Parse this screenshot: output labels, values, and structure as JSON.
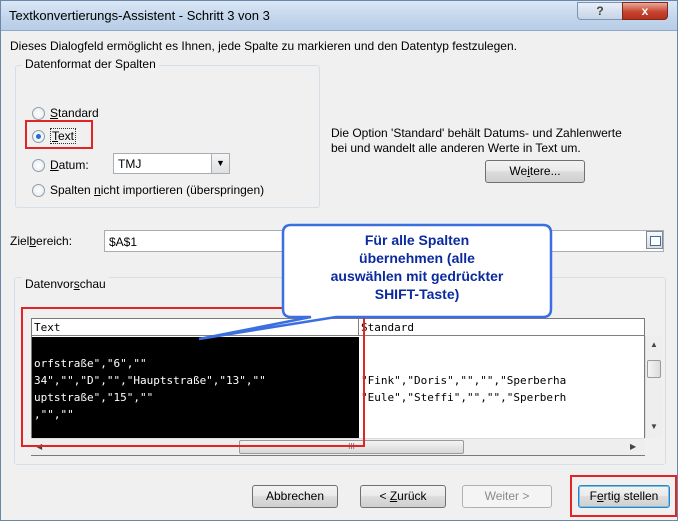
{
  "window": {
    "title": "Textkonvertierungs-Assistent - Schritt 3 von 3",
    "help_glyph": "?",
    "close_glyph": "x"
  },
  "intro": "Dieses Dialogfeld ermöglicht es Ihnen, jede Spalte zu markieren und den Datentyp festzulegen.",
  "format_group": {
    "label": "Datenformat der Spalten",
    "options": [
      {
        "pre": "",
        "u": "S",
        "post": "tandard",
        "checked": false
      },
      {
        "pre": "",
        "u": "T",
        "post": "ext",
        "checked": true
      },
      {
        "pre": "",
        "u": "D",
        "post": "atum:",
        "checked": false
      },
      {
        "pre": "Spalten ",
        "u": "n",
        "post": "icht importieren (überspringen)",
        "checked": false
      }
    ],
    "date_format": "TMJ"
  },
  "note": {
    "line1": "Die Option 'Standard' behält Datums- und Zahlenwerte",
    "line2": "bei und wandelt alle anderen Werte in Text um.",
    "button_pre": "We",
    "button_u": "i",
    "button_post": "tere..."
  },
  "target": {
    "label_pre": "Ziel",
    "label_u": "b",
    "label_post": "ereich:",
    "value": "$A$1"
  },
  "preview": {
    "label_pre": "Datenvor",
    "label_u": "s",
    "label_post": "chau",
    "columns": [
      "Text",
      "Standard"
    ],
    "col1_rows": [
      "",
      "orfstraße\",\"6\",\"\"",
      "34\",\"\",\"D\",\"\",\"Hauptstraße\",\"13\",\"\"",
      "uptstraße\",\"15\",\"\"",
      ",\"\",\"\""
    ],
    "col2_rows": [
      "",
      "",
      "\"Fink\",\"Doris\",\"\",\"\",\"Sperberha",
      "\"Eule\",\"Steffi\",\"\",\"\",\"Sperberh",
      ""
    ],
    "hscroll_grip": "III"
  },
  "callout": {
    "line1": "Für alle Spalten",
    "line2": "übernehmen (alle",
    "line3": "auswählen mit gedrückter",
    "line4": "SHIFT-Taste)"
  },
  "buttons": {
    "cancel": "Abbrechen",
    "back_pre": "< ",
    "back_u": "Z",
    "back_post": "urück",
    "next": "Weiter >",
    "finish_pre": "F",
    "finish_u": "e",
    "finish_post": "rtig stellen"
  },
  "colors": {
    "highlight": "#e32424",
    "callout_fill": "#ffffff",
    "callout_border": "#3b6fe0",
    "callout_text": "#0a2aa0"
  }
}
